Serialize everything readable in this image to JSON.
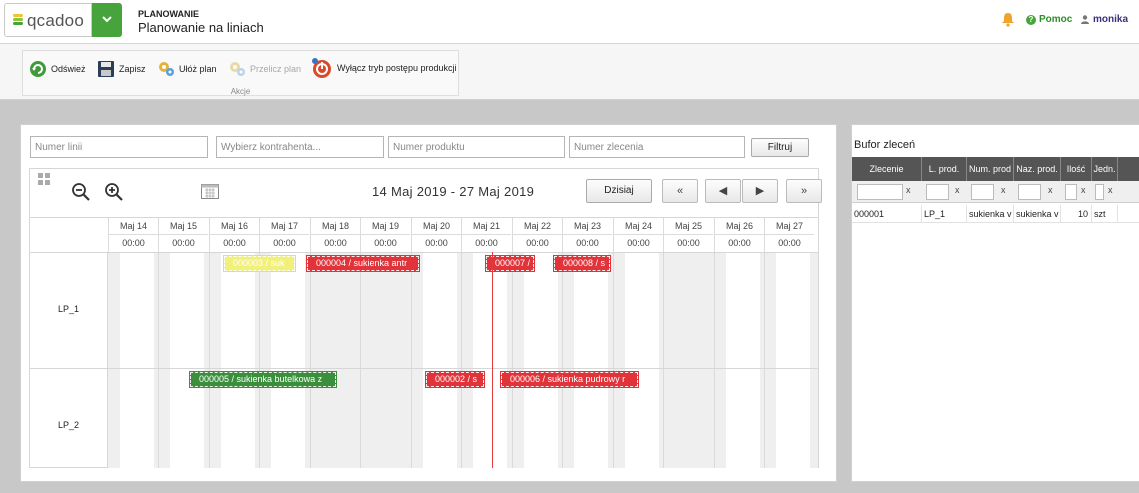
{
  "app": {
    "logo_text": "qcadoo",
    "breadcrumb_section": "PLANOWANIE",
    "page_title": "Planowanie na liniach",
    "help_label": "Pomoc",
    "user_name": "monika"
  },
  "toolbar": {
    "refresh": "Odśwież",
    "save": "Zapisz",
    "arrange": "Ułóż plan",
    "recalculate": "Przelicz plan",
    "progress_mode": "Wyłącz tryb postępu produkcji",
    "group_caption": "Akcje"
  },
  "filters": {
    "line_placeholder": "Numer linii",
    "contractor_placeholder": "Wybierz kontrahenta...",
    "product_placeholder": "Numer produktu",
    "order_placeholder": "Numer zlecenia",
    "filter_button": "Filtruj"
  },
  "gantt": {
    "date_range": "14 Maj 2019 - 27 Maj 2019",
    "today_button": "Dzisiaj",
    "days": [
      {
        "date": "Maj 14",
        "time": "00:00"
      },
      {
        "date": "Maj 15",
        "time": "00:00"
      },
      {
        "date": "Maj 16",
        "time": "00:00"
      },
      {
        "date": "Maj 17",
        "time": "00:00"
      },
      {
        "date": "Maj 18",
        "time": "00:00"
      },
      {
        "date": "Maj 19",
        "time": "00:00"
      },
      {
        "date": "Maj 20",
        "time": "00:00"
      },
      {
        "date": "Maj 21",
        "time": "00:00"
      },
      {
        "date": "Maj 22",
        "time": "00:00"
      },
      {
        "date": "Maj 23",
        "time": "00:00"
      },
      {
        "date": "Maj 24",
        "time": "00:00"
      },
      {
        "date": "Maj 25",
        "time": "00:00"
      },
      {
        "date": "Maj 26",
        "time": "00:00"
      },
      {
        "date": "Maj 27",
        "time": "00:00"
      }
    ],
    "lines": [
      "LP_1",
      "LP_2"
    ],
    "tasks": [
      {
        "label": "000003 / suk",
        "color": "#f1f07a"
      },
      {
        "label": "000004 / sukienka antr",
        "color": "#e0333a"
      },
      {
        "label": "000007 /",
        "color": "#e0333a"
      },
      {
        "label": "000008 / s",
        "color": "#e0333a"
      },
      {
        "label": "000005 / sukienka butelkowa z",
        "color": "#3b8f3c"
      },
      {
        "label": "000002 / s",
        "color": "#e0333a"
      },
      {
        "label": "000006 / sukienka pudrowy r",
        "color": "#e0333a"
      }
    ]
  },
  "buffer": {
    "title": "Bufor zleceń",
    "columns": [
      "Zlecenie",
      "L. prod.",
      "Num. prod",
      "Naz. prod.",
      "Ilość",
      "Jedn."
    ],
    "clear_symbol": "x",
    "rows": [
      [
        "000001",
        "LP_1",
        "sukienka v",
        "sukienka v",
        "10",
        "szt"
      ]
    ]
  }
}
